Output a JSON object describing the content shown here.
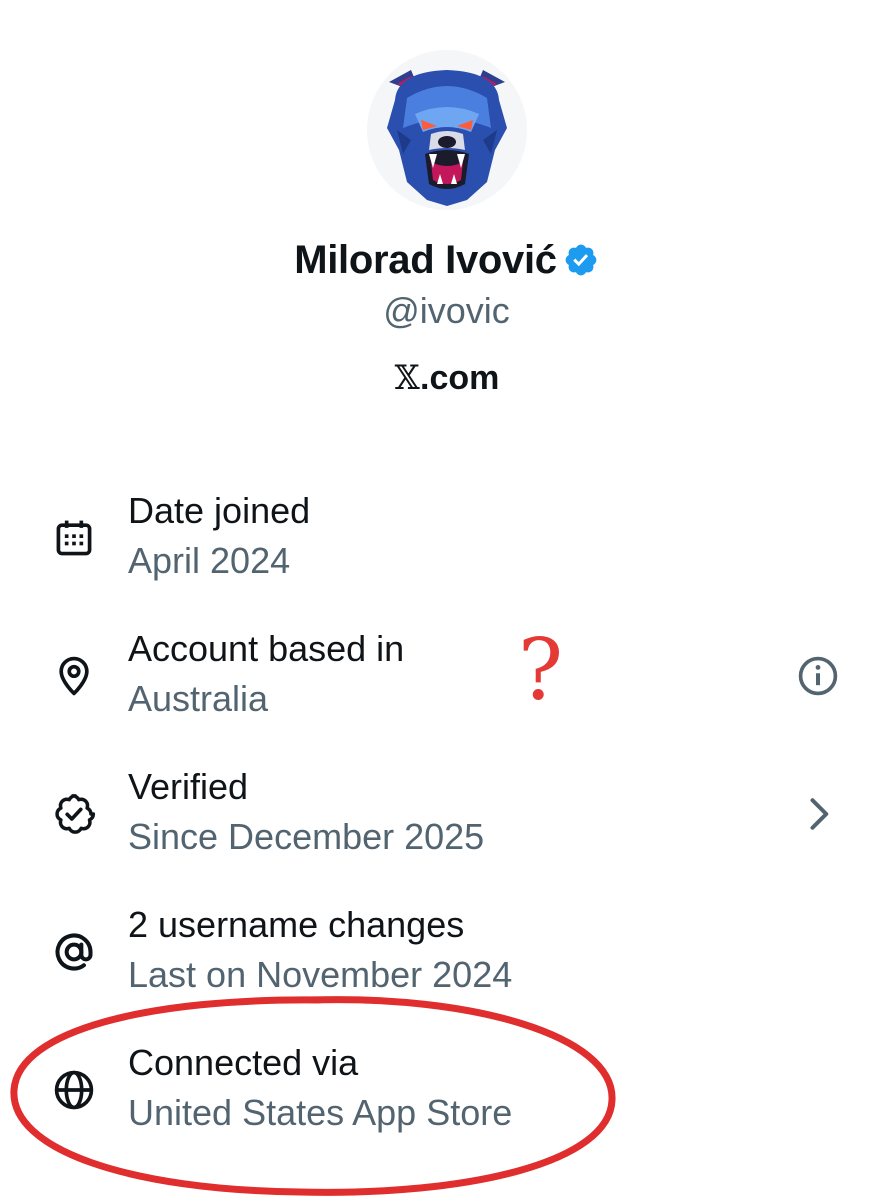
{
  "profile": {
    "display_name": "Milorad Ivović",
    "handle": "@ivovic",
    "website_text": ".com",
    "website_logo": "𝕏"
  },
  "about_items": [
    {
      "icon": "calendar-icon",
      "title": "Date joined",
      "subtitle": "April 2024"
    },
    {
      "icon": "location-pin-icon",
      "title": "Account based in",
      "subtitle": "Australia",
      "right_icon": "info-icon"
    },
    {
      "icon": "verified-badge-icon",
      "title": "Verified",
      "subtitle": "Since December 2025",
      "right_icon": "chevron-right-icon"
    },
    {
      "icon": "at-sign-icon",
      "title": "2 username changes",
      "subtitle": "Last on November 2024"
    },
    {
      "icon": "globe-icon",
      "title": "Connected via",
      "subtitle": "United States App Store"
    }
  ],
  "annotations": {
    "question_mark": "?",
    "highlight_color": "#e53935"
  },
  "colors": {
    "primary_text": "#0f1419",
    "secondary_text": "#536471",
    "verified_blue": "#1d9bf0"
  }
}
